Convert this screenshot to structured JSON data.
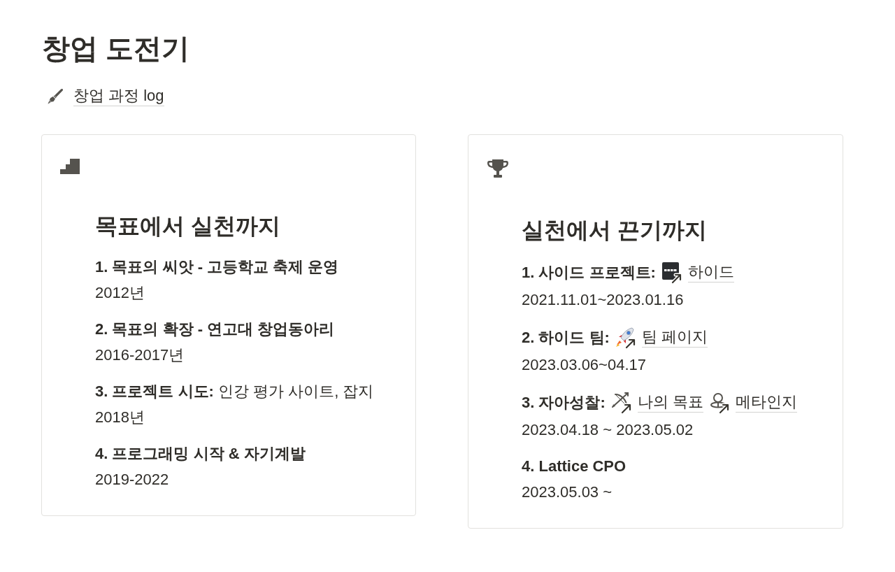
{
  "page": {
    "title": "창업 도전기"
  },
  "header_link": {
    "kind": "pen",
    "label": "창업 과정 log"
  },
  "cards": [
    {
      "kind": "stairs",
      "heading": "목표에서 실천까지",
      "items": [
        {
          "title": "1. 목표의 씨앗 - 고등학교 축제 운영",
          "date": "2012년"
        },
        {
          "title": "2. 목표의 확장 - 연고대 창업동아리",
          "date": "2016-2017년"
        },
        {
          "title": "3. 프로젝트 시도:",
          "note": "인강 평가 사이트, 잡지",
          "date": "2018년"
        },
        {
          "title": "4. 프로그래밍 시작 & 자기계발",
          "date": "2019-2022"
        }
      ]
    },
    {
      "kind": "trophy",
      "heading": "실천에서 끈기까지",
      "items": [
        {
          "title": "1. 사이드 프로젝트:",
          "links": [
            {
              "kind": "logo",
              "label": "하이드"
            }
          ],
          "date": "2021.11.01~2023.01.16"
        },
        {
          "title": "2. 하이드 팀:",
          "links": [
            {
              "kind": "rocket",
              "label": "팀 페이지"
            }
          ],
          "date": "2023.03.06~04.17"
        },
        {
          "title": "3. 자아성찰:",
          "links": [
            {
              "kind": "bow",
              "label": "나의 목표"
            },
            {
              "kind": "head",
              "label": "메타인지"
            }
          ],
          "date": "2023.04.18 ~ 2023.05.02"
        },
        {
          "title": "4. Lattice CPO",
          "date": "2023.05.03 ~"
        }
      ]
    }
  ]
}
